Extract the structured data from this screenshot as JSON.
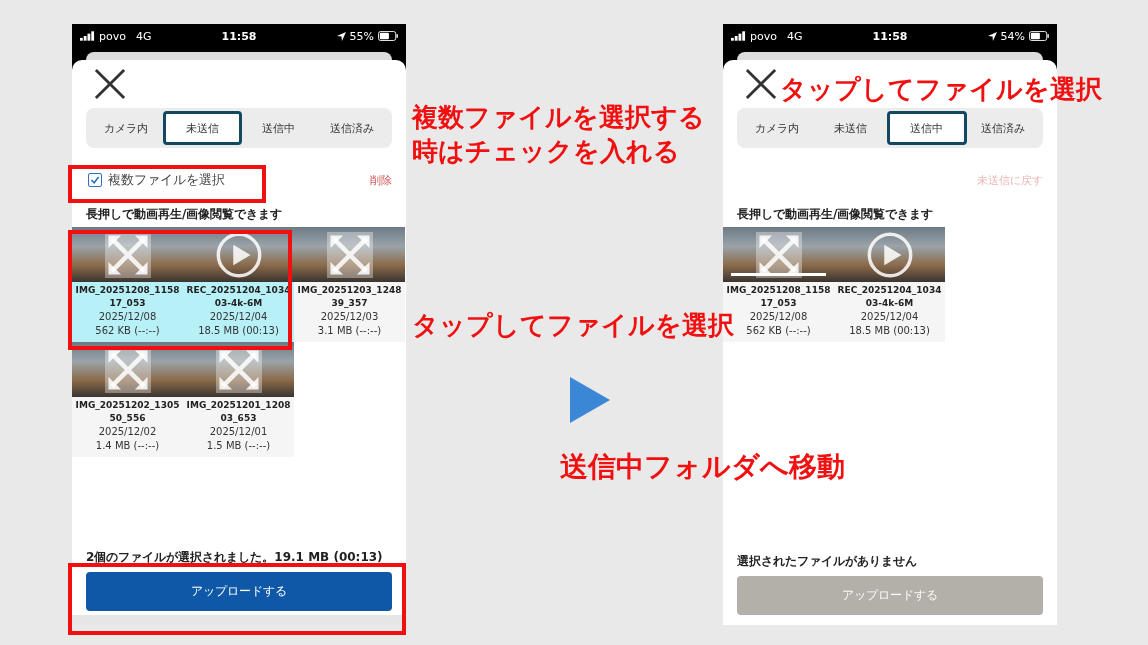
{
  "screens": [
    {
      "status_bar": {
        "carrier": "povo",
        "network": "4G",
        "time": "11:58",
        "battery": "55%"
      },
      "tabs": [
        {
          "label": "カメラ内",
          "selected": false
        },
        {
          "label": "未送信",
          "selected": true
        },
        {
          "label": "送信中",
          "selected": false
        },
        {
          "label": "送信済み",
          "selected": false
        }
      ],
      "select_multiple": {
        "label": "複数ファイルを選択",
        "checked": true
      },
      "action_link": {
        "label": "削除",
        "disabled": false
      },
      "hint": "長押しで動画再生/画像閲覧できます",
      "files": [
        {
          "kind": "photo",
          "name": "IMG_20251208_115817_053",
          "date": "2025/12/08",
          "size": "562 KB (--:--)",
          "selected": true,
          "uploading": false
        },
        {
          "kind": "video",
          "name": "REC_20251204_103403-4k-6M",
          "date": "2025/12/04",
          "size": "18.5 MB (00:13)",
          "selected": true,
          "uploading": false
        },
        {
          "kind": "photo",
          "name": "IMG_20251203_124839_357",
          "date": "2025/12/03",
          "size": "3.1 MB (--:--)",
          "selected": false,
          "uploading": false
        },
        {
          "kind": "photo",
          "name": "IMG_20251202_130550_556",
          "date": "2025/12/02",
          "size": "1.4 MB (--:--)",
          "selected": false,
          "uploading": false
        },
        {
          "kind": "photo",
          "name": "IMG_20251201_120803_653",
          "date": "2025/12/01",
          "size": "1.5 MB (--:--)",
          "selected": false,
          "uploading": false
        }
      ],
      "footer_status": "2個のファイルが選択されました。19.1 MB (00:13)",
      "upload_button": {
        "label": "アップロードする",
        "disabled": false
      }
    },
    {
      "status_bar": {
        "carrier": "povo",
        "network": "4G",
        "time": "11:58",
        "battery": "54%"
      },
      "tabs": [
        {
          "label": "カメラ内",
          "selected": false
        },
        {
          "label": "未送信",
          "selected": false
        },
        {
          "label": "送信中",
          "selected": true
        },
        {
          "label": "送信済み",
          "selected": false
        }
      ],
      "action_link": {
        "label": "未送信に戻す",
        "disabled": true
      },
      "hint": "長押しで動画再生/画像閲覧できます",
      "files": [
        {
          "kind": "photo",
          "name": "IMG_20251208_115817_053",
          "date": "2025/12/08",
          "size": "562 KB (--:--)",
          "selected": false,
          "uploading": true
        },
        {
          "kind": "video",
          "name": "REC_20251204_103403-4k-6M",
          "date": "2025/12/04",
          "size": "18.5 MB (00:13)",
          "selected": false,
          "uploading": false
        }
      ],
      "footer_status": "選択されたファイルがありません",
      "upload_button": {
        "label": "アップロードする",
        "disabled": true
      }
    }
  ],
  "annotations": [
    {
      "kind": "callout",
      "text": "複数ファイルを選択する時はチェックを入れる"
    },
    {
      "kind": "callout",
      "text": "タップしてファイルを選択"
    },
    {
      "kind": "caption",
      "text": "送信中フォルダへ移動"
    },
    {
      "kind": "callout",
      "text": "タップしてファイルを選択"
    }
  ]
}
